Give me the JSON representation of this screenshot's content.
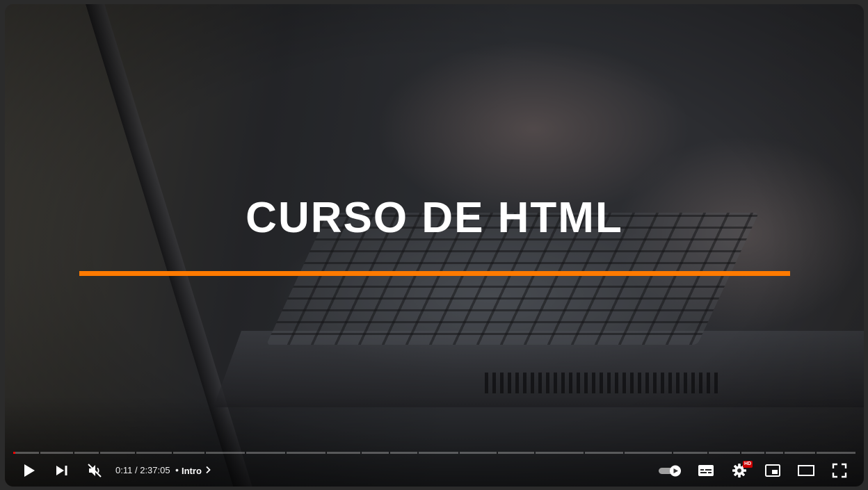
{
  "video": {
    "title_overlay": "CURSO DE HTML",
    "accent_color": "#ff7a00"
  },
  "player": {
    "progress_fraction": 0.0012,
    "progress_color": "#ff0000",
    "chapter_segments": 24,
    "time": {
      "current": "0:11",
      "separator": "/",
      "duration": "2:37:05"
    },
    "chapter": {
      "bullet": "•",
      "label": "Intro"
    },
    "settings_badge": "HD",
    "icons": {
      "play": "play-icon",
      "next": "next-icon",
      "mute": "volume-muted-icon",
      "autoplay": "autoplay-toggle-icon",
      "subtitles": "subtitles-icon",
      "settings": "gear-icon",
      "miniplayer": "miniplayer-icon",
      "theater": "theater-mode-icon",
      "fullscreen": "fullscreen-icon"
    }
  }
}
